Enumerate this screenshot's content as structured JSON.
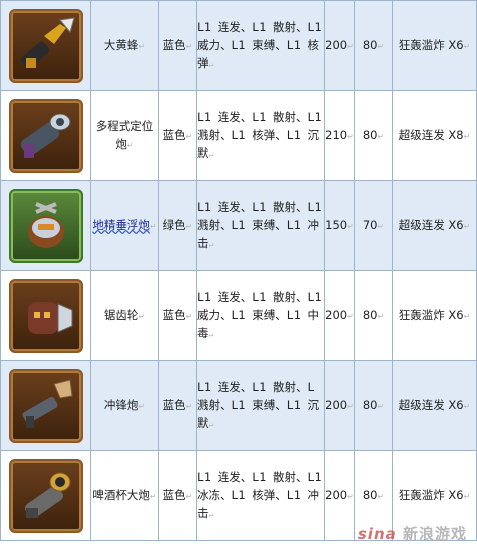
{
  "weapons": [
    {
      "name": "大黄蜂",
      "color": "蓝色",
      "effects": "L1 连发、L1 散射、L1 威力、L1 束缚、L1 核弹",
      "attack": "200",
      "range": "80",
      "skill": "狂轰滥炸 X6",
      "icon": "hornet-gun-icon",
      "frame": "brown"
    },
    {
      "name": "多程式定位炮",
      "color": "蓝色",
      "effects": "L1 连发、L1 散射、L1 溅射、L1 核弹、L1 沉默",
      "attack": "210",
      "range": "80",
      "skill": "超级连发 X8",
      "icon": "multi-range-cannon-icon",
      "frame": "brown"
    },
    {
      "name": "地精垂浮炮",
      "color": "绿色",
      "effects": "L1 连发、L1 散射、L1 溅射、L1 束缚、L1 冲击",
      "attack": "150",
      "range": "70",
      "skill": "超级连发 X6",
      "icon": "goblin-hover-cannon-icon",
      "frame": "green"
    },
    {
      "name": "锯齿轮",
      "color": "蓝色",
      "effects": "L1 连发、L1 散射、L1 威力、L1 束缚、L1 中毒",
      "attack": "200",
      "range": "80",
      "skill": "狂轰滥炸 X6",
      "icon": "saw-gear-icon",
      "frame": "brown"
    },
    {
      "name": "冲锋炮",
      "color": "蓝色",
      "effects": "L1 连发、L1 散射、L 溅射、L1 束缚、L1 沉默",
      "attack": "200",
      "range": "80",
      "skill": "超级连发 X6",
      "icon": "charge-cannon-icon",
      "frame": "brown"
    },
    {
      "name": "啤酒杯大炮",
      "color": "蓝色",
      "effects": "L1 连发、L1 散射、L1 冰冻、L1 核弹、L1 冲击",
      "attack": "200",
      "range": "80",
      "skill": "狂轰滥炸 X6",
      "icon": "beer-mug-cannon-icon",
      "frame": "brown"
    }
  ],
  "watermark": {
    "logo": "sina",
    "text": "新浪游戏"
  }
}
